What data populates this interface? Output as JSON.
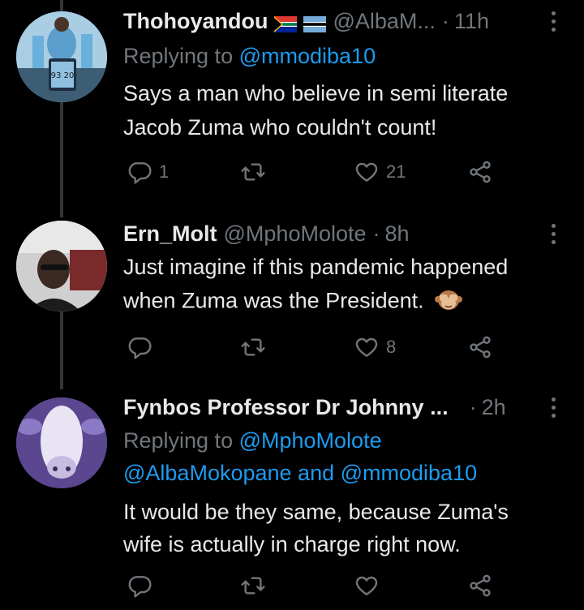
{
  "tweets": [
    {
      "name": "Thohoyandou",
      "handle": "@AlbaM...",
      "time": "11h",
      "reply_prefix": "Replying to ",
      "reply_to": "@mmodiba10",
      "text": [
        "Says a man who believe in semi literate",
        "Jacob Zuma who couldn't count!"
      ],
      "replies": "1",
      "retweets": "",
      "likes": "21",
      "jersey_text": "93 20"
    },
    {
      "name": "Ern_Molt",
      "handle": "@MphoMolote",
      "time": "8h",
      "text": [
        "Just imagine if this pandemic happened",
        "when Zuma was the President."
      ],
      "replies": "",
      "retweets": "",
      "likes": "8"
    },
    {
      "name": "Fynbos Professor Dr Johnny ...",
      "handle": "",
      "time": "2h",
      "reply_prefix": "Replying to ",
      "reply_to": "@MphoMolote",
      "reply_to_2": "@AlbaMokopane",
      "reply_and": " and ",
      "reply_to_3": "@mmodiba10",
      "text": [
        "It would be they same, because Zuma's",
        "wife is actually in charge right now."
      ],
      "replies": "",
      "retweets": "",
      "likes": ""
    }
  ],
  "colors": {
    "background": "#000000",
    "text": "#e7e9ea",
    "muted": "#71767b",
    "link": "#1d9bf0",
    "thread_line": "#333639"
  },
  "icons": [
    "reply-icon",
    "retweet-icon",
    "like-icon",
    "share-icon",
    "more-icon"
  ]
}
